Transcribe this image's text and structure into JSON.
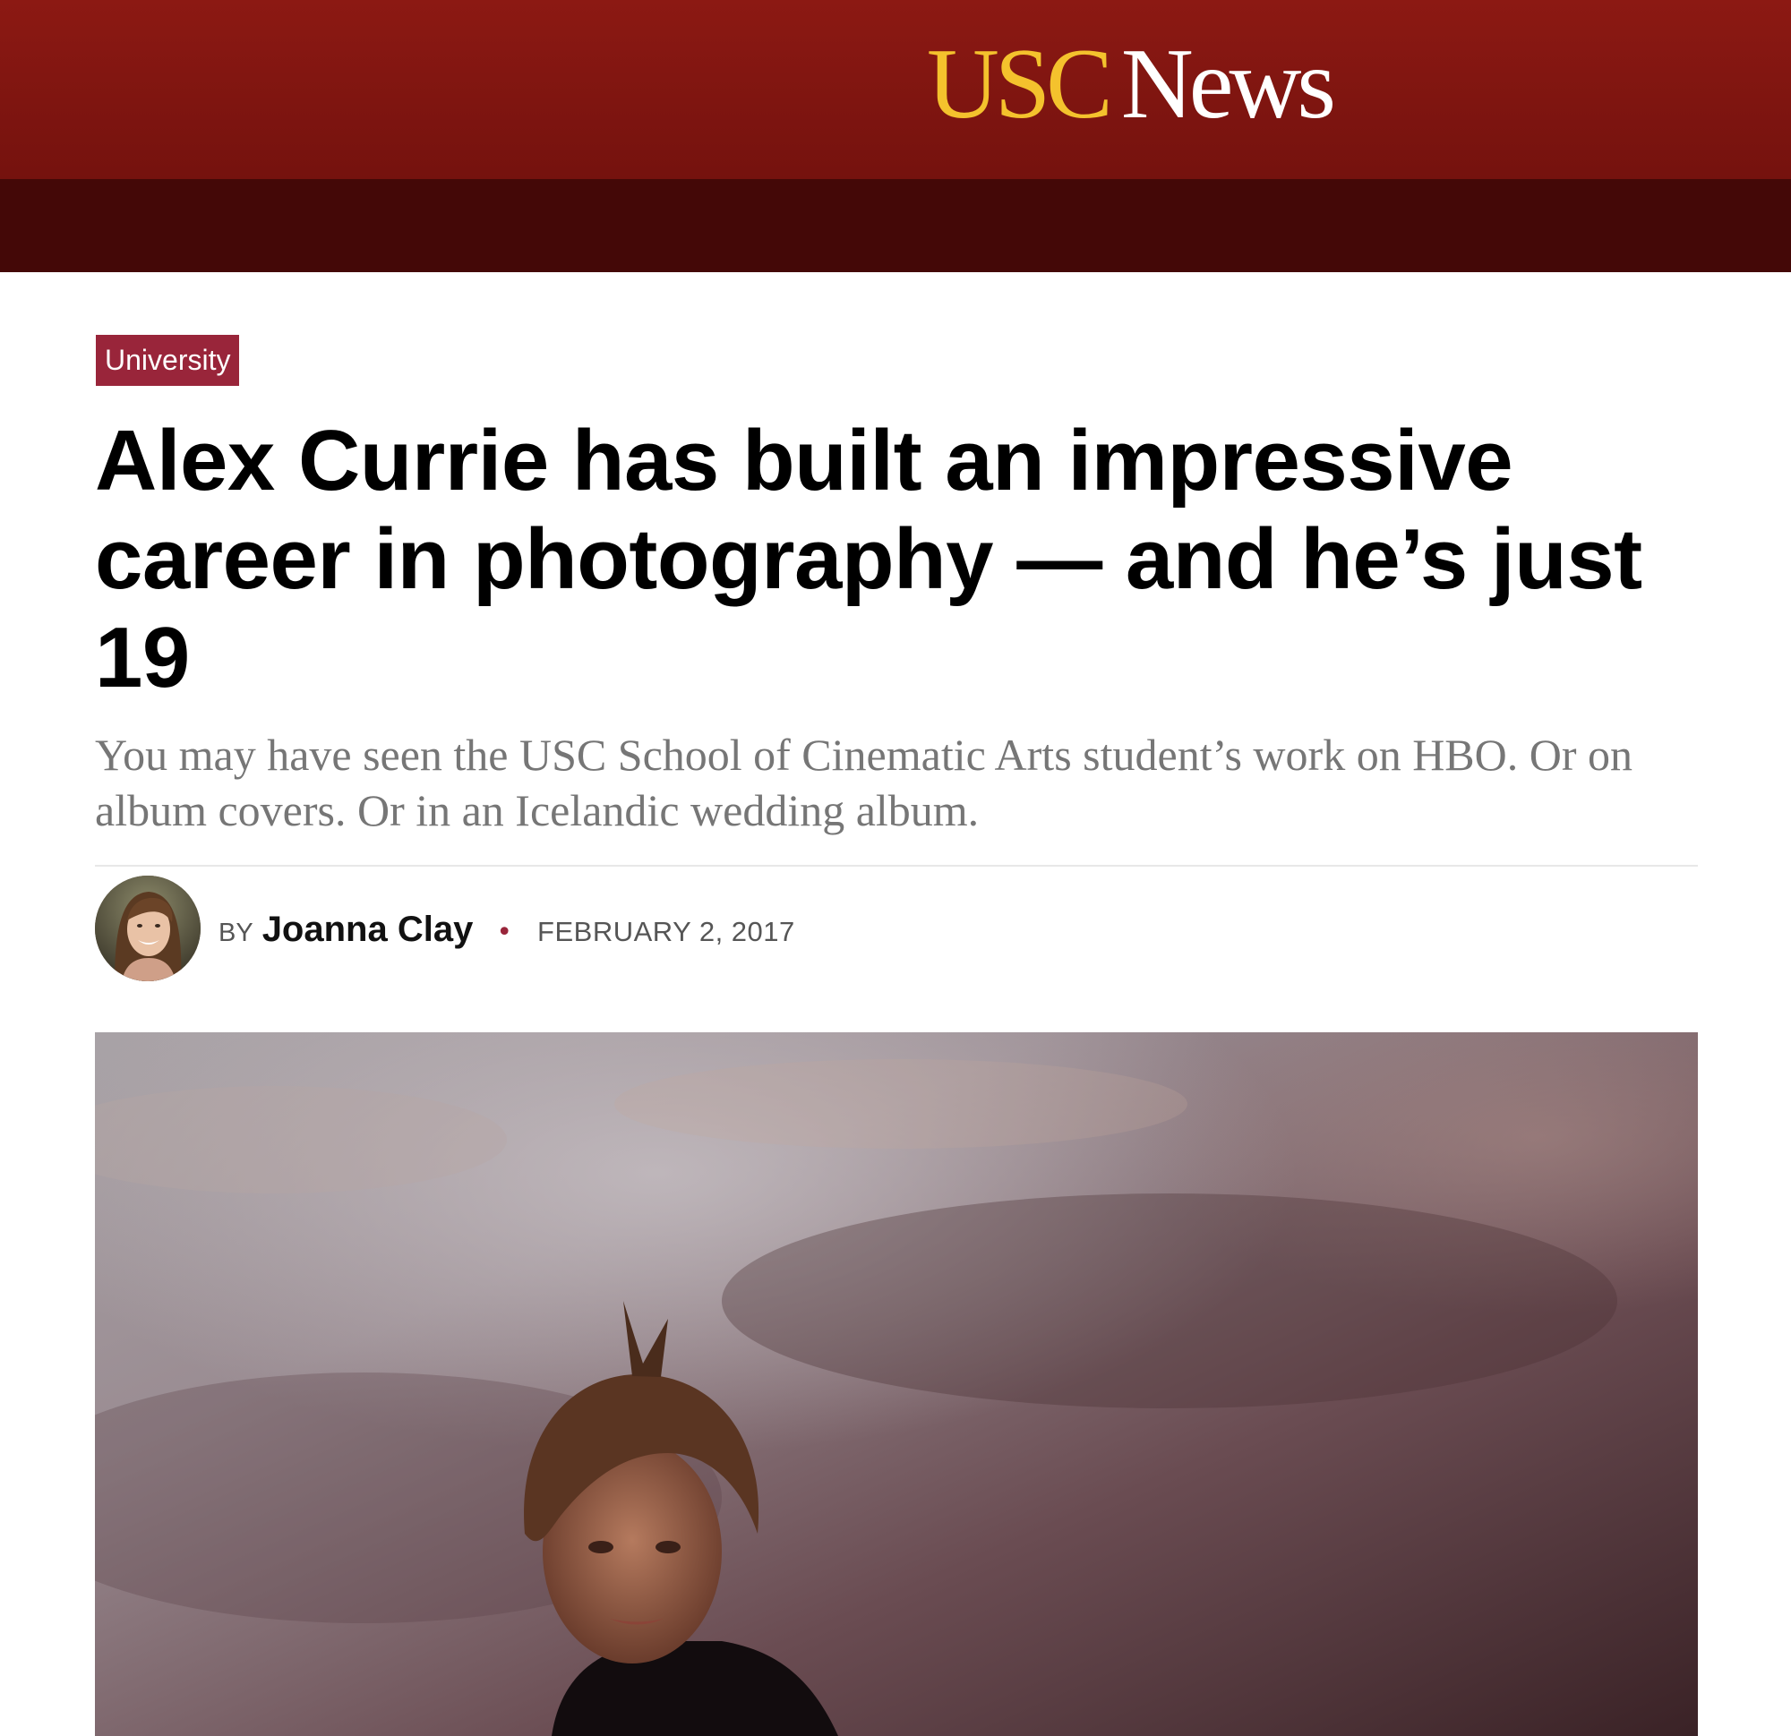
{
  "header": {
    "logo_usc": "USC",
    "logo_news": "News"
  },
  "article": {
    "category": "University",
    "headline": "Alex Currie has built an impressive career in photography — and he’s just 19",
    "deck": "You may have seen the USC School of Cinematic Arts student’s work on HBO. Or on album covers. Or in an Icelandic wedding album.",
    "byline": {
      "by_label": "BY",
      "author": "Joanna Clay",
      "separator": "•",
      "date": "FEBRUARY 2, 2017"
    }
  },
  "colors": {
    "header_red": "#8c1913",
    "nav_dark": "#440807",
    "usc_gold": "#f4c22d",
    "category_bg": "#99253a",
    "deck_gray": "#767676"
  },
  "icons": {
    "author_photo": "author-avatar",
    "hero": "hero-photo"
  }
}
